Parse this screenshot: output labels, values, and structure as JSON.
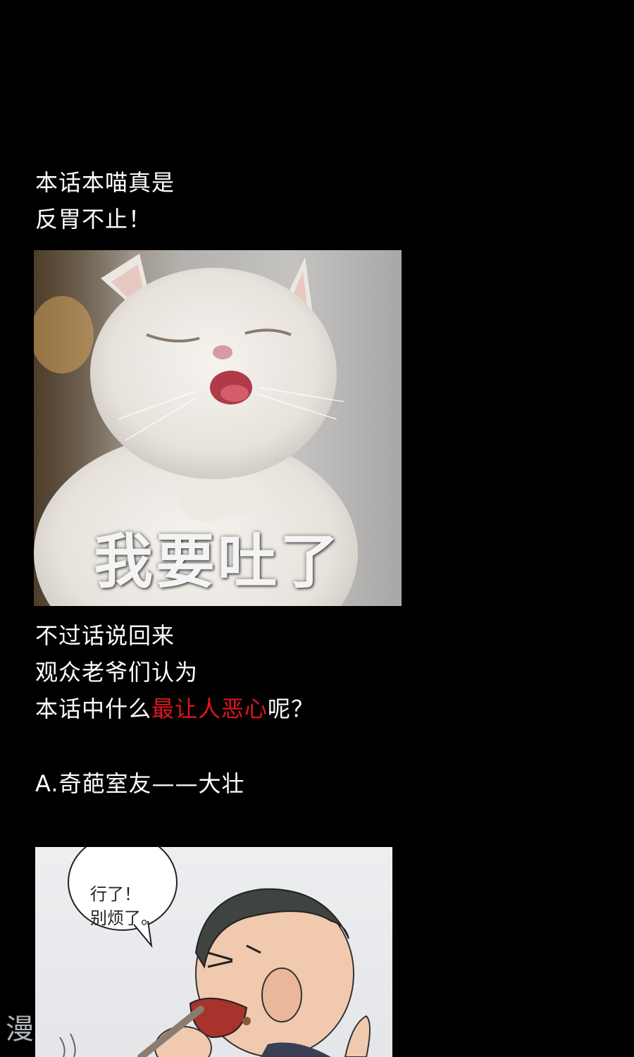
{
  "intro": {
    "line1": "本话本喵真是",
    "line2": "反胃不止！"
  },
  "cat_image": {
    "caption": "我要吐了"
  },
  "question": {
    "line1": "不过话说回来",
    "line2": "观众老爷们认为",
    "line3_prefix": "本话中什么",
    "line3_highlight": "最让人恶心",
    "line3_suffix": "呢？"
  },
  "option_a": {
    "label": "A.奇葩室友——大壮"
  },
  "comic": {
    "bubble_line1": "行了！",
    "bubble_line2": "别烦了。"
  },
  "watermark": {
    "text": "漫"
  },
  "colors": {
    "background": "#000000",
    "highlight": "#e0141e"
  }
}
